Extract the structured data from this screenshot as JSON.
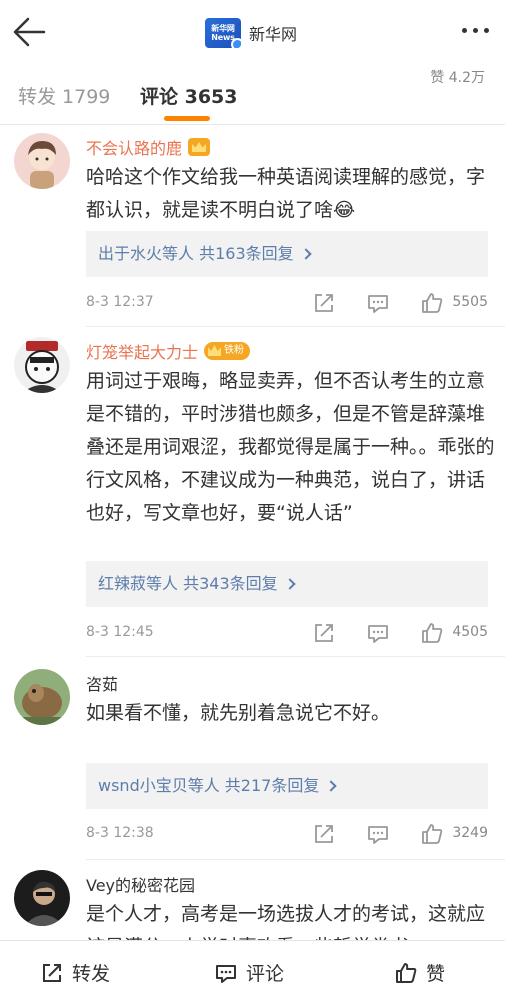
{
  "header": {
    "account_name": "新华网",
    "logo_text": "新华网 News"
  },
  "tabs": {
    "repost": "转发 1799",
    "comments": "评论 3653",
    "likes": "赞 4.2万"
  },
  "comments": [
    {
      "username": "不会认路的鹿",
      "badge": "crown",
      "text": "哈哈这个作文给我一种英语阅读理解的感觉，字都认识，就是读不明白说了啥😂",
      "reply_summary": "出于水火等人 共163条回复",
      "time": "8-3 12:37",
      "likes": "5505"
    },
    {
      "username": "灯笼举起大力士",
      "badge": "iron",
      "badge_label": "铁粉",
      "text": "用词过于艰晦，略显卖弄，但不否认考生的立意是不错的，平时涉猎也颇多，但是不管是辞藻堆叠还是用词艰涩，我都觉得是属于一种。。乖张的行文风格，不建议成为一种典范，说白了，讲话也好，写文章也好，要“说人话”",
      "reply_summary": "红辣菽等人 共343条回复",
      "time": "8-3 12:45",
      "likes": "4505"
    },
    {
      "username": "咨茹",
      "badge": "none",
      "text": "如果看不懂，就先别着急说它不好。",
      "reply_summary": "wsnd小宝贝等人 共217条回复",
      "time": "8-3 12:38",
      "likes": "3249"
    },
    {
      "username": "Vey的秘密花园",
      "badge": "none",
      "text": "是个人才，高考是一场选拔人才的考试，这就应该是满分。上学时喜欢看一些哲学类书"
    }
  ],
  "bottom": {
    "repost": "转发",
    "comment": "评论",
    "like": "赞"
  },
  "colors": {
    "accent": "#ff8200",
    "username": "#eb7350",
    "link": "#5d7dab"
  }
}
